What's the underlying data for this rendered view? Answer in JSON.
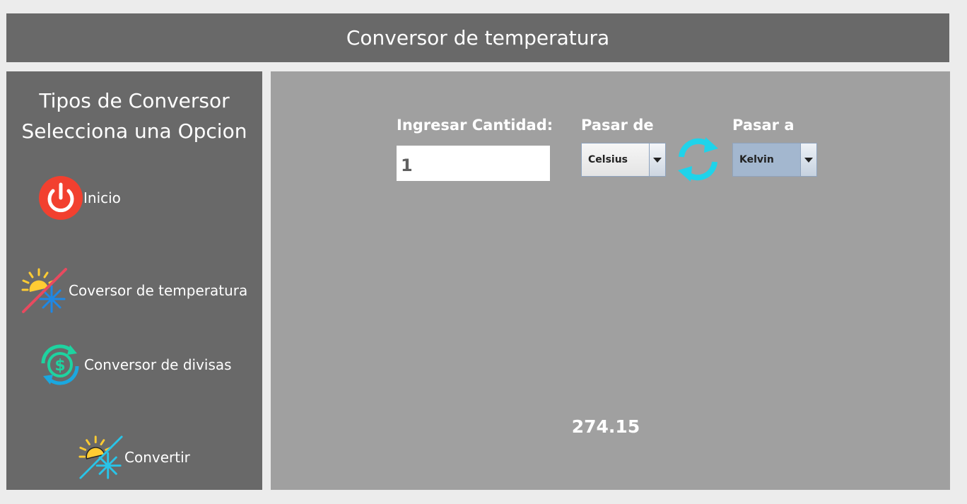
{
  "header": {
    "title": "Conversor de temperatura"
  },
  "sidebar": {
    "title_line1": "Tipos de Conversor",
    "title_line2": "Selecciona una Opcion",
    "items": [
      {
        "label": "Inicio",
        "icon": "power-icon"
      },
      {
        "label": "Coversor de temperatura",
        "icon": "sun-snowflake-icon"
      },
      {
        "label": "Conversor de divisas",
        "icon": "currency-exchange-icon"
      },
      {
        "label": "Convertir",
        "icon": "sun-snowflake-icon"
      }
    ]
  },
  "form": {
    "amount_label": "Ingresar Cantidad:",
    "amount_value": "1",
    "from_label": "Pasar de",
    "from_selected": "Celsius",
    "to_label": "Pasar a",
    "to_selected": "Kelvin",
    "swap_icon": "swap-arrows-icon"
  },
  "result": {
    "value": "274.15"
  },
  "colors": {
    "header_bg": "#696969",
    "sidebar_bg": "#696969",
    "main_bg": "#a0a0a0",
    "power_red": "#f2402f",
    "swap_cyan": "#1fd3ea",
    "sun_yellow": "#ffcc33",
    "snow_blue": "#1e88e5"
  }
}
